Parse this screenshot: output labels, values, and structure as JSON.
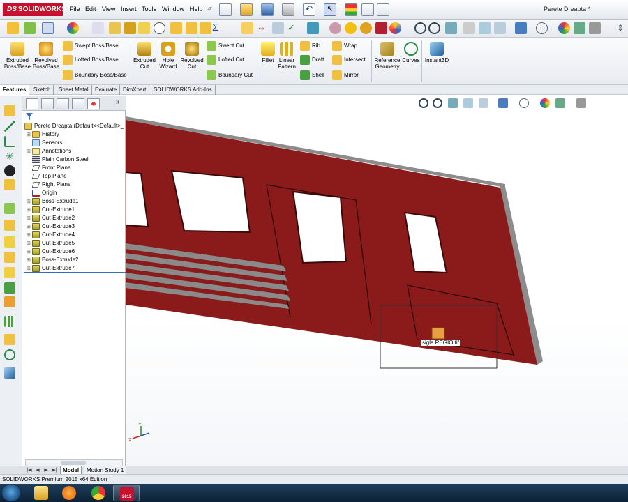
{
  "app": {
    "brand": "SOLIDWORKS",
    "document_title": "Perete Dreapta *",
    "menus": [
      "File",
      "Edit",
      "View",
      "Insert",
      "Tools",
      "Window",
      "Help"
    ]
  },
  "command_manager": {
    "big_buttons": [
      "Extruded Boss/Base",
      "Revolved Boss/Base",
      "Extruded Cut",
      "Hole Wizard",
      "Revolved Cut",
      "Fillet",
      "Linear Pattern",
      "Reference Geometry",
      "Curves",
      "Instant3D"
    ],
    "boss_column": [
      "Swept Boss/Base",
      "Lofted Boss/Base",
      "Boundary Boss/Base"
    ],
    "cut_column": [
      "Swept Cut",
      "Lofted Cut",
      "Boundary Cut"
    ],
    "features_col1": [
      "Rib",
      "Draft",
      "Shell"
    ],
    "features_col2": [
      "Wrap",
      "Intersect",
      "Mirror"
    ]
  },
  "tabs": [
    "Features",
    "Sketch",
    "Sheet Metal",
    "Evaluate",
    "DimXpert",
    "SOLIDWORKS Add-Ins"
  ],
  "active_tab": "Features",
  "feature_tree": {
    "root": "Perete Dreapta  (Default<<Default>_",
    "items": [
      {
        "label": "History",
        "icon": "folder-icon",
        "expandable": true
      },
      {
        "label": "Sensors",
        "icon": "sensor-icon",
        "expandable": false
      },
      {
        "label": "Annotations",
        "icon": "annotation-icon",
        "expandable": true
      },
      {
        "label": "Plain Carbon Steel",
        "icon": "material-icon",
        "expandable": false
      },
      {
        "label": "Front Plane",
        "icon": "plane-icon",
        "expandable": false
      },
      {
        "label": "Top Plane",
        "icon": "plane-icon",
        "expandable": false
      },
      {
        "label": "Right Plane",
        "icon": "plane-icon",
        "expandable": false
      },
      {
        "label": "Origin",
        "icon": "origin-icon",
        "expandable": false
      },
      {
        "label": "Boss-Extrude1",
        "icon": "extrude-icon",
        "expandable": true
      },
      {
        "label": "Cut-Extrude1",
        "icon": "extrude-icon",
        "expandable": true
      },
      {
        "label": "Cut-Extrude2",
        "icon": "extrude-icon",
        "expandable": true
      },
      {
        "label": "Cut-Extrude3",
        "icon": "extrude-icon",
        "expandable": true
      },
      {
        "label": "Cut-Extrude4",
        "icon": "extrude-icon",
        "expandable": true
      },
      {
        "label": "Cut-Extrude5",
        "icon": "extrude-icon",
        "expandable": true
      },
      {
        "label": "Cut-Extrude6",
        "icon": "extrude-icon",
        "expandable": true
      },
      {
        "label": "Boss-Extrude2",
        "icon": "extrude-icon",
        "expandable": true
      },
      {
        "label": "Cut-Extrude7",
        "icon": "extrude-icon",
        "expandable": true
      }
    ]
  },
  "viewport": {
    "image_label": "sigla REGIO.tif",
    "part_color": "#8b1a1a",
    "edge_color": "#8c8c8c"
  },
  "bottom_tabs": [
    "Model",
    "Motion Study 1"
  ],
  "status_text": "SOLIDWORKS Premium 2015 x64 Edition",
  "taskbar": {
    "solidworks_badge": "2015"
  },
  "colors": {
    "brand_red": "#c8102e",
    "taskbar": "#16324e"
  }
}
